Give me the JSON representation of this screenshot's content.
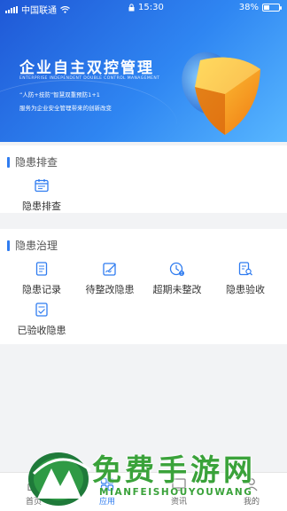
{
  "status_bar": {
    "carrier": "中国联通",
    "time": "15:30",
    "battery": "38%",
    "battery_level": 0.38
  },
  "banner": {
    "title": "企业自主双控管理",
    "subtitle_en": "ENTERPRISE INDEPENDENT DOUBLE CONTROL MANAGEMENT",
    "line1": "“人防+技防”智慧双重预防1+1",
    "line2": "服务为企业安全管理带来的创新改变"
  },
  "sections": {
    "inspection": {
      "title": "隐患排查",
      "items": [
        {
          "label": "隐患排查",
          "icon": "calendar-icon"
        }
      ]
    },
    "governance": {
      "title": "隐患治理",
      "items": [
        {
          "label": "隐患记录",
          "icon": "document-icon"
        },
        {
          "label": "待整改隐患",
          "icon": "edit-icon"
        },
        {
          "label": "超期未整改",
          "icon": "clock-alert-icon"
        },
        {
          "label": "隐患验收",
          "icon": "search-document-icon"
        },
        {
          "label": "已验收隐患",
          "icon": "checked-document-icon"
        }
      ]
    }
  },
  "bottom_nav": {
    "items": [
      {
        "label": "首页",
        "icon": "home-icon"
      },
      {
        "label": "应用",
        "icon": "apps-icon",
        "active": true
      },
      {
        "label": "资讯",
        "icon": "monitor-icon"
      },
      {
        "label": "我的",
        "icon": "user-icon"
      }
    ]
  },
  "watermark": {
    "title": "免费手游网",
    "subtitle": "MIANFEISHOUYOUWANG"
  },
  "colors": {
    "primary": "#2f7cf0",
    "banner_start": "#1f58d6",
    "banner_end": "#58b7ff",
    "watermark": "#3aa23a"
  }
}
